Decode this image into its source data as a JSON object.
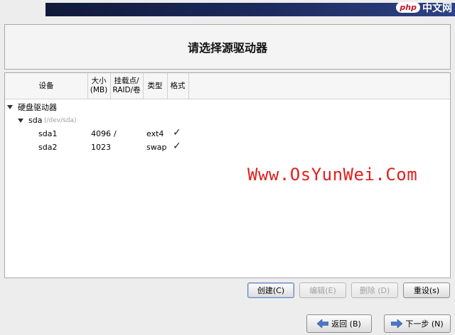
{
  "brand": {
    "logo": "php",
    "text": "中文网"
  },
  "page_title": "请选择源驱动器",
  "columns": {
    "device": "设备",
    "size_line1": "大小",
    "size_line2": "(MB)",
    "mount_line1": "挂载点/",
    "mount_line2": "RAID/卷",
    "type": "类型",
    "format": "格式"
  },
  "tree": {
    "group_label": "硬盘驱动器",
    "disk_name": "sda",
    "disk_path": "(/dev/sda)",
    "partitions": [
      {
        "device": "sda1",
        "size": "4096",
        "mount": "/",
        "type": "ext4",
        "format": "✓"
      },
      {
        "device": "sda2",
        "size": "1023",
        "mount": "",
        "type": "swap",
        "format": "✓"
      }
    ]
  },
  "watermark": "Www.OsYunWei.Com",
  "actions": {
    "create": "创建(C)",
    "edit": "编辑(E)",
    "delete": "删除 (D)",
    "reset": "重设(s)"
  },
  "nav": {
    "back": "返回 (B)",
    "next": "下一步 (N)"
  },
  "icons": {
    "back": "arrow-left-icon",
    "next": "arrow-right-icon",
    "expand": "expand-triangle-icon"
  },
  "colors": {
    "banner": "#1c2a5e",
    "watermark": "#e0201d",
    "arrow": "#4a78c8"
  }
}
